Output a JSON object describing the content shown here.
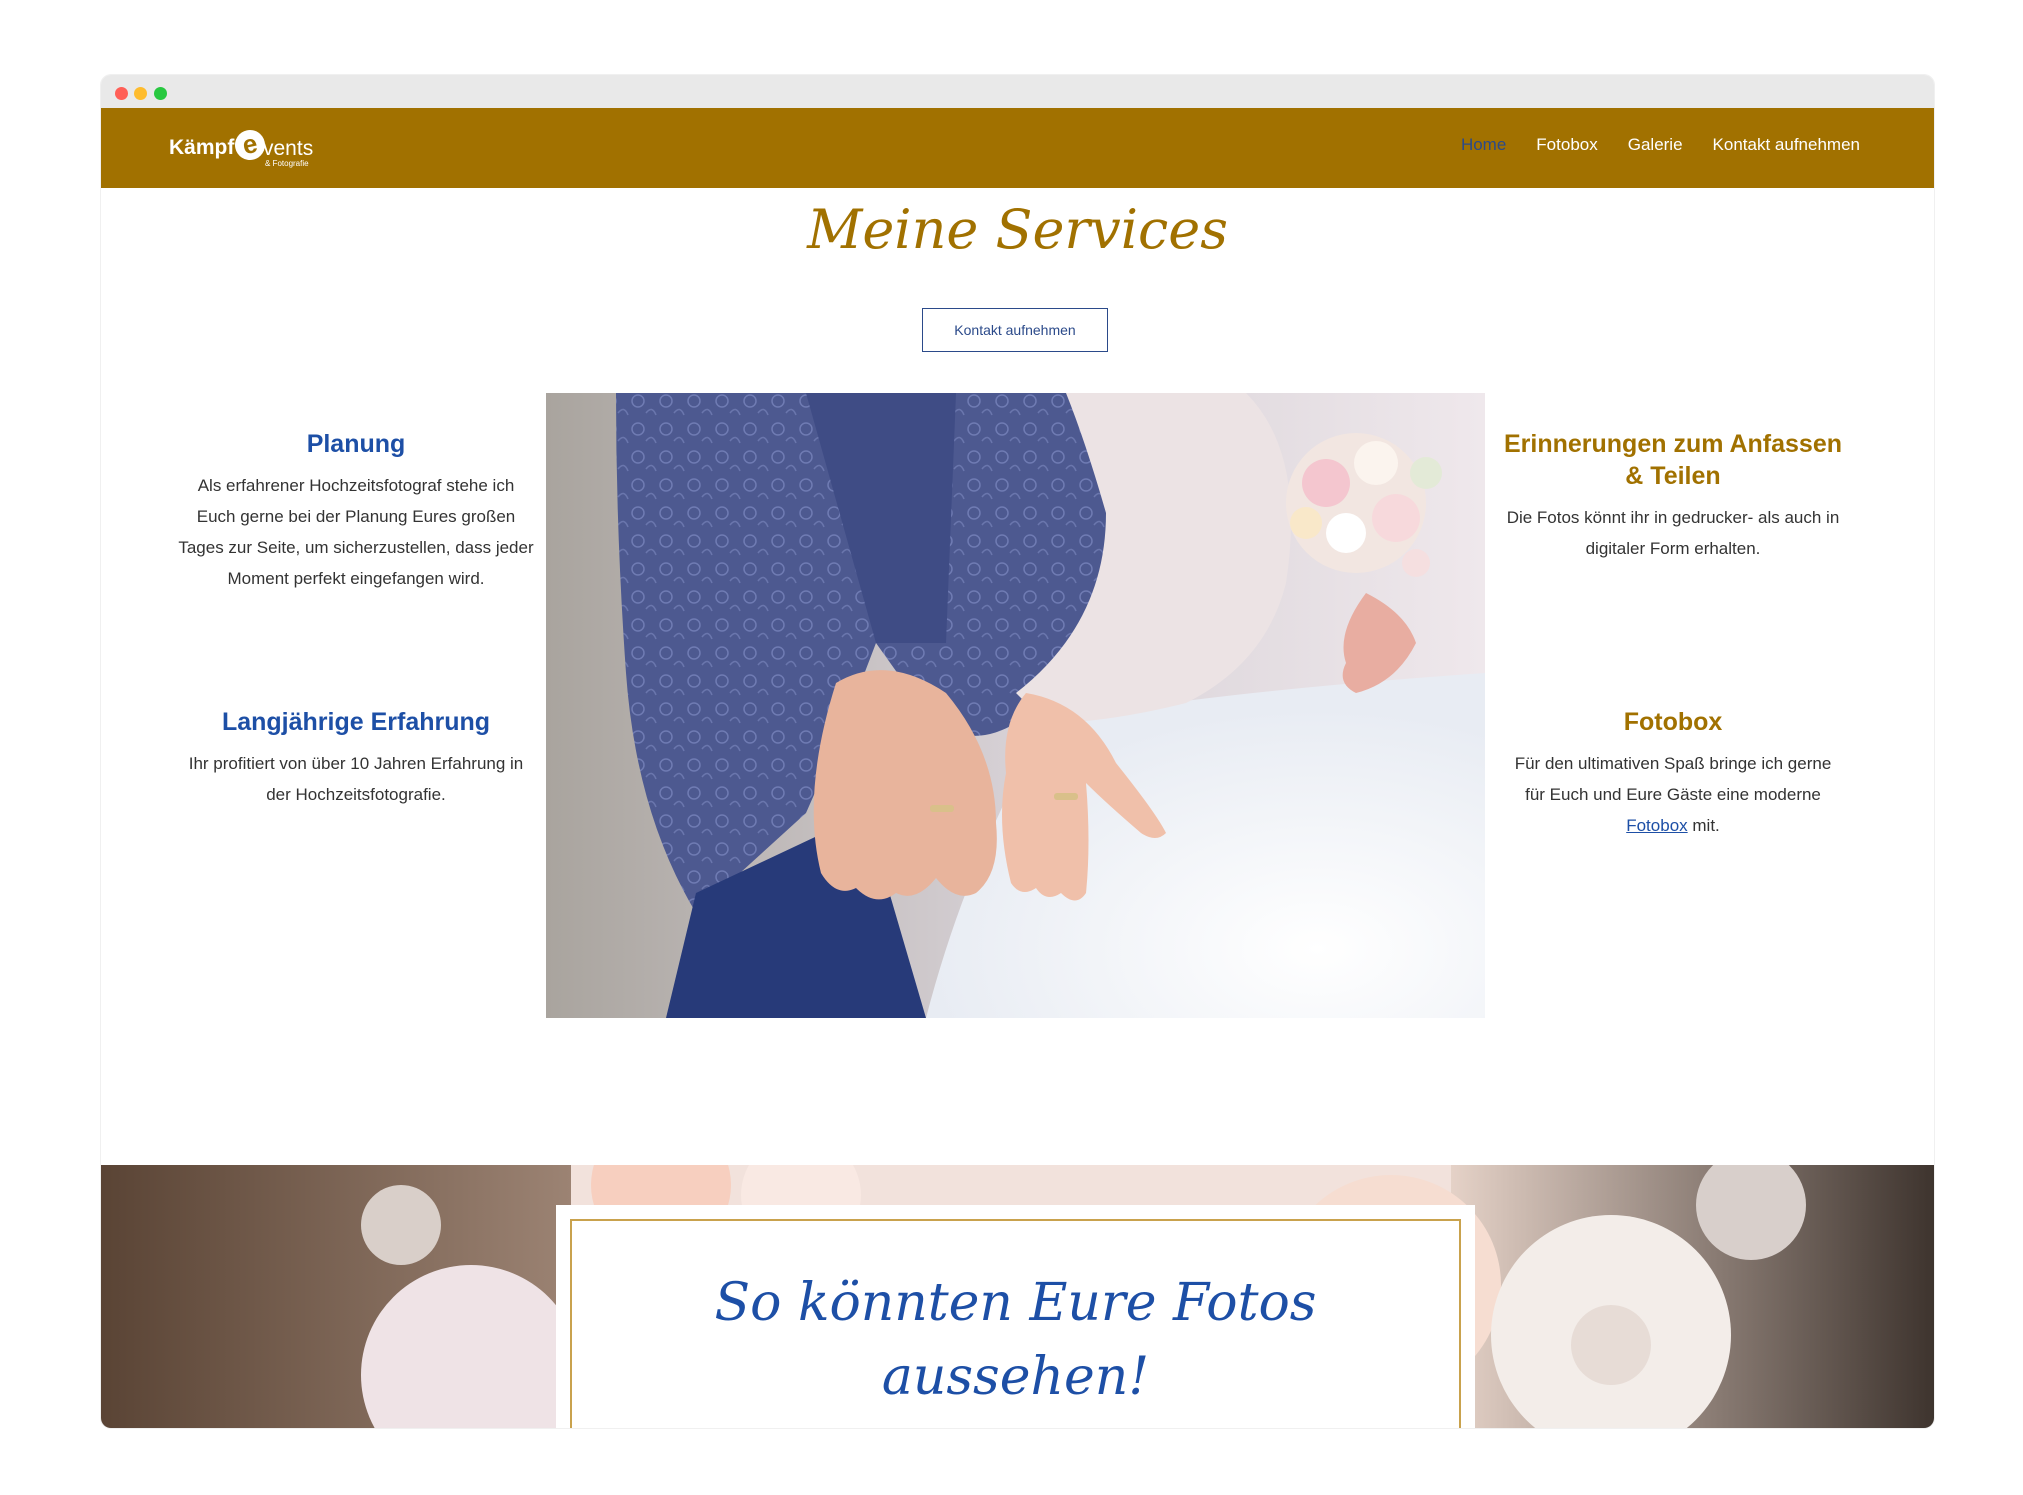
{
  "nav": {
    "logo_main": "Kämpf",
    "logo_e": "e",
    "logo_rest": "vents",
    "logo_sub": "& Fotografie",
    "items": [
      {
        "label": "Home",
        "active": true
      },
      {
        "label": "Fotobox",
        "active": false
      },
      {
        "label": "Galerie",
        "active": false
      },
      {
        "label": "Kontakt aufnehmen",
        "active": false
      }
    ]
  },
  "section": {
    "heading": "Meine Services",
    "cta_label": "Kontakt aufnehmen"
  },
  "services": [
    {
      "title": "Planung",
      "text": "Als erfahrener Hochzeitsfotograf stehe ich Euch gerne bei der Planung Eures großen Tages zur Seite, um sicherzustellen, dass jeder Moment perfekt eingefangen wird."
    },
    {
      "title": "Langjährige Erfahrung",
      "text": "Ihr profitiert von über 10 Jahren Erfahrung in der Hochzeitsfotografie."
    },
    {
      "title": "Erinnerungen zum Anfassen & Teilen",
      "text": "Die Fotos könnt ihr in gedrucker- als auch in digitaler Form erhalten."
    },
    {
      "title": "Fotobox",
      "text_before": "Für den ultimativen Spaß bringe ich gerne für Euch und Eure Gäste eine moderne",
      "link": "Fotobox",
      "text_after": "mit."
    }
  ],
  "banner": {
    "title_line1": "So könnten Eure Fotos",
    "title_line2": "aussehen!"
  },
  "colors": {
    "brand_gold": "#a17100",
    "accent_blue": "#1d4fa6",
    "frame_gold": "#c9a24d"
  }
}
